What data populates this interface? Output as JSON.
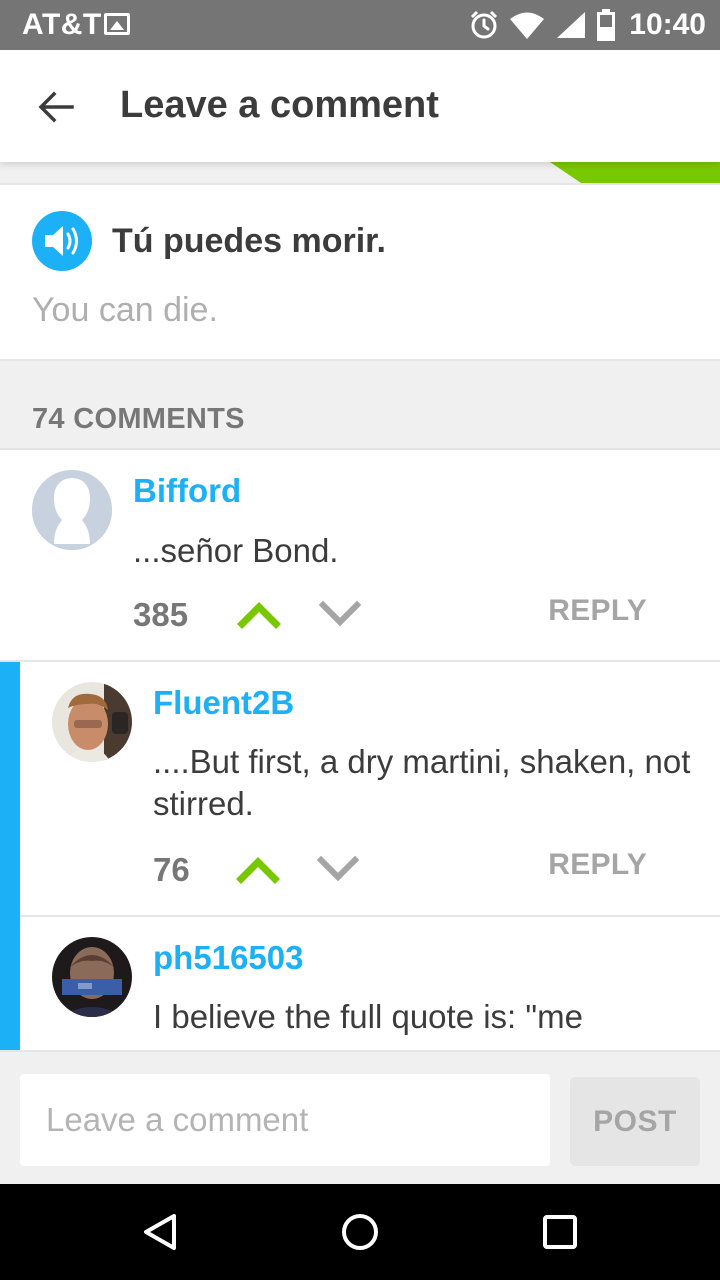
{
  "status_bar": {
    "carrier": "AT&T",
    "time": "10:40",
    "icons": [
      "gallery-icon",
      "alarm-icon",
      "wifi-icon",
      "signal-icon",
      "battery-icon"
    ]
  },
  "app_bar": {
    "title": "Leave a comment",
    "back_icon": "arrow-left-icon"
  },
  "sentence": {
    "text": "Tú puedes morir.",
    "translation": "You can die.",
    "audio_icon": "speaker-icon"
  },
  "comments_header": {
    "count_label": "74 COMMENTS"
  },
  "comments": [
    {
      "username": "Bifford",
      "text": "...señor Bond.",
      "votes": "385",
      "reply_label": "REPLY",
      "is_reply": false
    },
    {
      "username": "Fluent2B",
      "text": "....But first, a dry martini, shaken, not stirred.",
      "votes": "76",
      "reply_label": "REPLY",
      "is_reply": true
    },
    {
      "username": "ph516503",
      "text": "I believe the full quote is: \"me",
      "is_reply": true
    }
  ],
  "input_bar": {
    "placeholder": "Leave a comment",
    "value": "",
    "post_label": "POST"
  },
  "nav_bar": {
    "icons": [
      "nav-back-icon",
      "nav-home-icon",
      "nav-recent-apps-icon"
    ]
  },
  "colors": {
    "accent_blue": "#1cb0f6",
    "upvote_green": "#78c800",
    "status_bar": "#757575",
    "text_dark": "#3c3c3c",
    "text_muted": "#afafaf"
  }
}
